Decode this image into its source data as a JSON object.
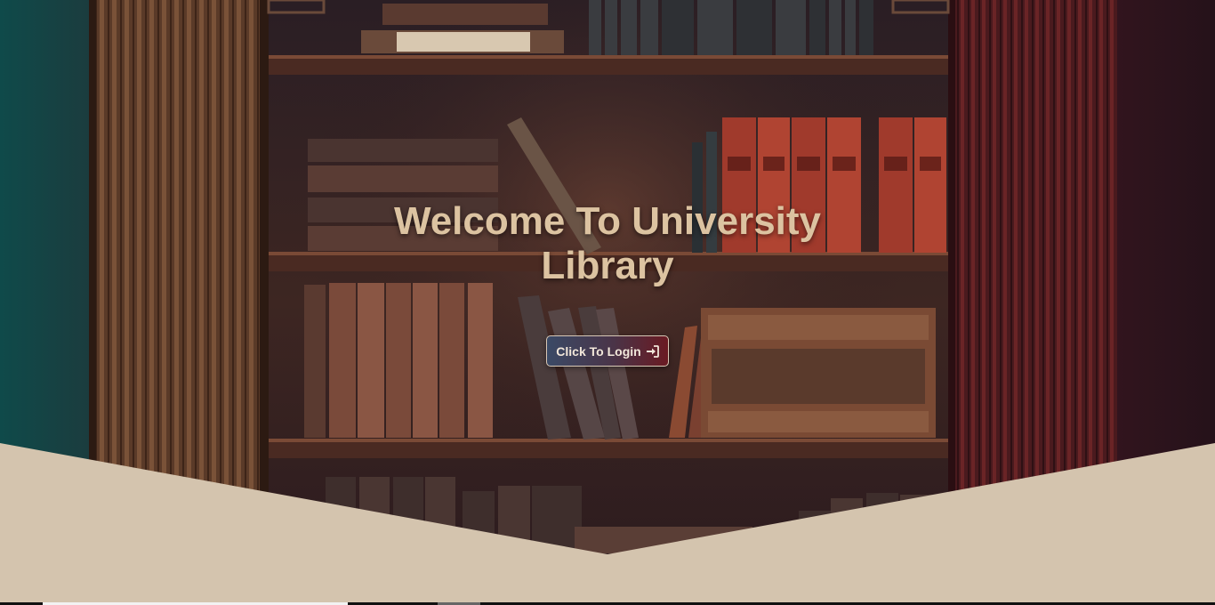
{
  "hero": {
    "title_line1": "Welcome To University",
    "title_line2": "Library",
    "background_image": "bookshelf-painting"
  },
  "login_button": {
    "label": "Click To Login",
    "icon": "sign-in-icon"
  },
  "colors": {
    "title": "#dcc3a1",
    "chevron_fill": "#d4c4ae",
    "button_gradient_start": "#3b4a66",
    "button_gradient_end": "#6a1a22",
    "button_border": "#d8c8b6"
  }
}
